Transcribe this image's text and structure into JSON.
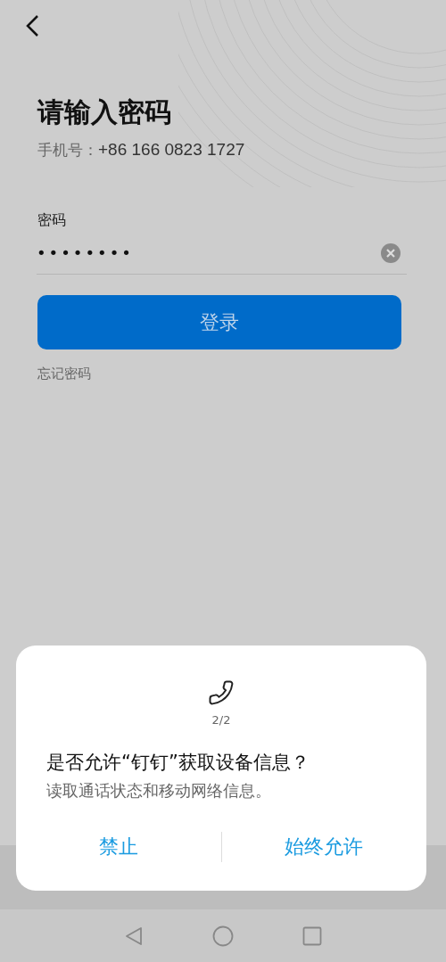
{
  "title": "请输入密码",
  "phone": {
    "label": "手机号：",
    "value": "+86 166 0823 1727"
  },
  "password": {
    "label": "密码",
    "value": "••••••••"
  },
  "login_button": "登录",
  "forgot_link": "忘记密码",
  "dialog": {
    "counter": "2/2",
    "title": "是否允许“钉钉”获取设备信息？",
    "message": "读取通话状态和移动网络信息。",
    "buttons": [
      {
        "label": "禁止"
      },
      {
        "label": "始终允许"
      }
    ]
  }
}
